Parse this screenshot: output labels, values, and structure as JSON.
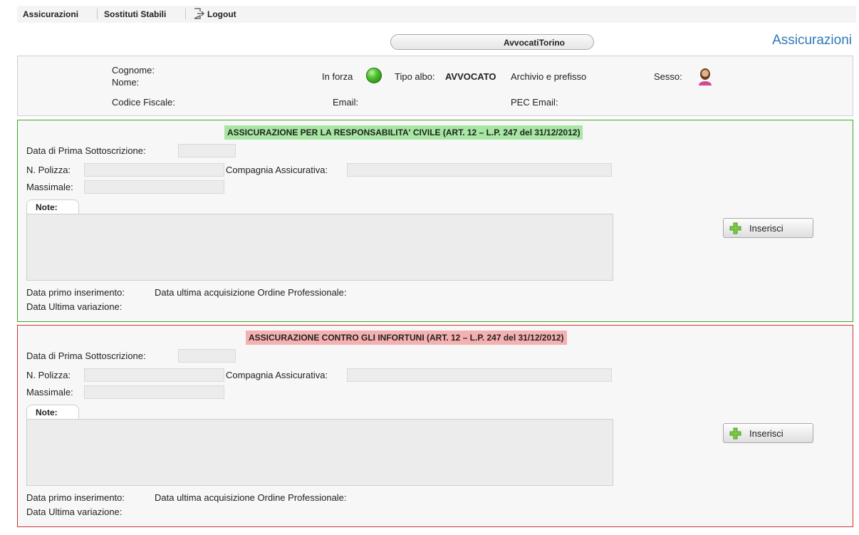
{
  "menu": {
    "insurance": "Assicurazioni",
    "substitutes": "Sostituti Stabili",
    "logout": "Logout"
  },
  "header": {
    "office": "AvvocatiTorino",
    "page_title": "Assicurazioni"
  },
  "info": {
    "surname_label": "Cognome:",
    "name_label": "Nome:",
    "fiscal_code_label": "Codice Fiscale:",
    "status_label": "In forza",
    "status_color": "#4dc02e",
    "register_type_label": "Tipo albo:",
    "register_type_value": "AVVOCATO",
    "archive_label": "Archivio e prefisso",
    "sex_label": "Sesso:",
    "email_label": "Email:",
    "pec_label": "PEC Email:"
  },
  "sections": [
    {
      "title": "ASSICURAZIONE PER LA RESPONSABILITA' CIVILE (ART. 12 – L.P. 247 del 31/12/2012)",
      "color": "#3fa32f",
      "first_subscription_label": "Data di Prima Sottoscrizione:",
      "policy_label": "N. Polizza:",
      "company_label": "Compagnia Assicurativa:",
      "ceiling_label": "Massimale:",
      "notes_tab": "Note:",
      "first_insert_label": "Data primo inserimento:",
      "last_acquisition_label": "Data ultima acquisizione Ordine Professionale:",
      "last_change_label": "Data Ultima variazione:",
      "insert_button": "Inserisci"
    },
    {
      "title": "ASSICURAZIONE CONTRO GLI INFORTUNI (ART. 12 – L.P. 247 del 31/12/2012)",
      "color": "#cc3333",
      "first_subscription_label": "Data di Prima Sottoscrizione:",
      "policy_label": "N. Polizza:",
      "company_label": "Compagnia Assicurativa:",
      "ceiling_label": "Massimale:",
      "notes_tab": "Note:",
      "first_insert_label": "Data primo inserimento:",
      "last_acquisition_label": "Data ultima acquisizione Ordine Professionale:",
      "last_change_label": "Data Ultima variazione:",
      "insert_button": "Inserisci"
    }
  ],
  "icons": {
    "logout": "logout-icon",
    "status": "status-dot-icon",
    "avatar": "female-avatar-icon",
    "plus": "plus-icon"
  }
}
